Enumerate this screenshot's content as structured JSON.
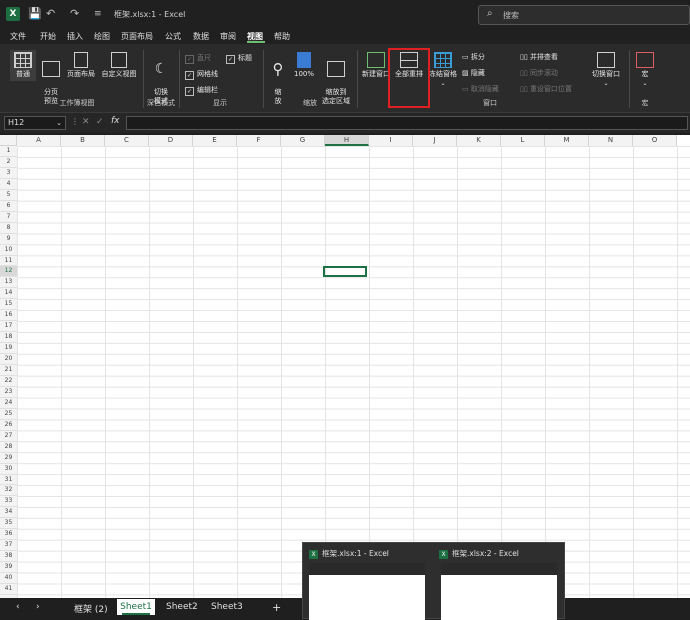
{
  "titlebar": {
    "doc_title": "框架.xlsx:1  -  Excel",
    "search_placeholder": "搜索",
    "excel_logo": "X",
    "qa_save": "💾",
    "qa_undo": "↶",
    "qa_redo": "↷",
    "qa_more": "≡"
  },
  "menu": {
    "tabs": [
      "文件",
      "开始",
      "插入",
      "绘图",
      "页面布局",
      "公式",
      "数据",
      "审阅",
      "视图",
      "帮助"
    ]
  },
  "ribbon": {
    "workbook_views": {
      "normal": "普通",
      "page_break_preview": "分页\n预览",
      "page_layout": "页面布局",
      "custom_views": "自定义视图",
      "group_label": "工作簿视图"
    },
    "dark_mode": {
      "switch_mode": "切换\n模式",
      "group_label": "深色模式"
    },
    "show": {
      "ruler": "直尺",
      "gridlines": "网格线",
      "formula_bar": "编辑栏",
      "headings": "标题",
      "group_label": "显示"
    },
    "zoom": {
      "zoom": "缩\n放",
      "zoom_100": "100%",
      "zoom_selection": "缩放到\n选定区域",
      "group_label": "缩放"
    },
    "window": {
      "new_window": "新建窗口",
      "arrange_all": "全部重排",
      "freeze_panes": "冻结窗格",
      "split": "拆分",
      "hide": "隐藏",
      "unhide": "取消隐藏",
      "view_side_by_side": "并排查看",
      "sync_scroll": "同步滚动",
      "reset_position": "重设窗口位置",
      "switch_windows": "切换窗口",
      "group_label": "窗口"
    },
    "macros": {
      "macros": "宏",
      "group_label": "宏"
    }
  },
  "formula_bar": {
    "name_box": "H12",
    "fx": "fx",
    "cancel": "✕",
    "confirm": "✓"
  },
  "grid": {
    "columns": [
      "A",
      "B",
      "C",
      "D",
      "E",
      "F",
      "G",
      "H",
      "I",
      "J",
      "K",
      "L",
      "M",
      "N",
      "O"
    ],
    "rows": [
      "1",
      "2",
      "3",
      "4",
      "5",
      "6",
      "7",
      "8",
      "9",
      "10",
      "11",
      "12",
      "13",
      "14",
      "15",
      "16",
      "17",
      "18",
      "19",
      "20",
      "21",
      "22",
      "23",
      "24",
      "25",
      "26",
      "27",
      "28",
      "29",
      "30",
      "31",
      "32",
      "33",
      "34",
      "35",
      "36",
      "37",
      "38",
      "39",
      "40",
      "41"
    ]
  },
  "sheets": {
    "nav_prev": "‹",
    "nav_next": "›",
    "tabs": [
      "框架 (2)",
      "Sheet1",
      "Sheet2",
      "Sheet3"
    ],
    "add": "+"
  },
  "thumbnails": {
    "items": [
      "框架.xlsx:1 - Excel",
      "框架.xlsx:2 - Excel"
    ]
  },
  "colors": {
    "accent": "#1e7145",
    "highlight_box": "#e02020"
  }
}
